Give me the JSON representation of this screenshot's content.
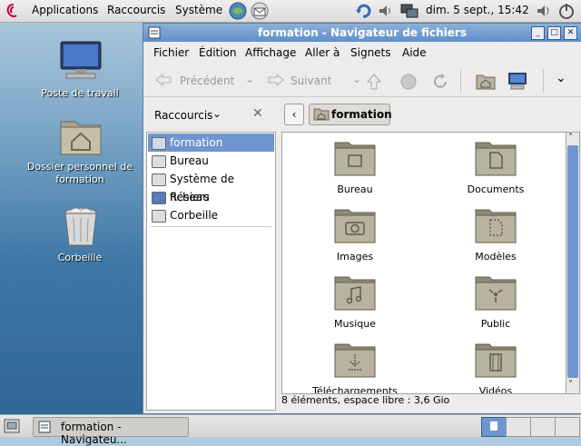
{
  "top_panel": {
    "menus": [
      "Applications",
      "Raccourcis",
      "Système"
    ],
    "clock": "dim.  5 sept., 15:42"
  },
  "desktop": {
    "icons": [
      {
        "label": "Poste de travail",
        "icon": "computer-icon"
      },
      {
        "label": "Dossier personnel de formation",
        "icon": "home-folder-icon"
      },
      {
        "label": "Corbeille",
        "icon": "trash-icon"
      }
    ]
  },
  "window": {
    "title": "formation - Navigateur de fichiers",
    "menubar": [
      "Fichier",
      "Édition",
      "Affichage",
      "Aller à",
      "Signets",
      "Aide"
    ],
    "toolbar": {
      "back": "Précédent",
      "forward": "Suivant"
    },
    "location": "formation",
    "sidebar": {
      "selector": "Raccourcis",
      "items": [
        "formation",
        "Bureau",
        "Système de fichiers",
        "Réseau",
        "Corbeille"
      ]
    },
    "folders": [
      {
        "label": "Bureau",
        "icon": "desktop-folder-icon"
      },
      {
        "label": "Documents",
        "icon": "documents-folder-icon"
      },
      {
        "label": "Images",
        "icon": "pictures-folder-icon"
      },
      {
        "label": "Modèles",
        "icon": "templates-folder-icon"
      },
      {
        "label": "Musique",
        "icon": "music-folder-icon"
      },
      {
        "label": "Public",
        "icon": "public-folder-icon"
      },
      {
        "label": "Téléchargements",
        "icon": "downloads-folder-icon"
      },
      {
        "label": "Vidéos",
        "icon": "videos-folder-icon"
      }
    ],
    "status": "8 éléments, espace libre : 3,6 Gio"
  },
  "taskbar": {
    "task": "formation - Navigateu..."
  },
  "colors": {
    "accent": "#5f8fc8",
    "selection": "#6f95d0",
    "folder": "#b7b39f"
  }
}
